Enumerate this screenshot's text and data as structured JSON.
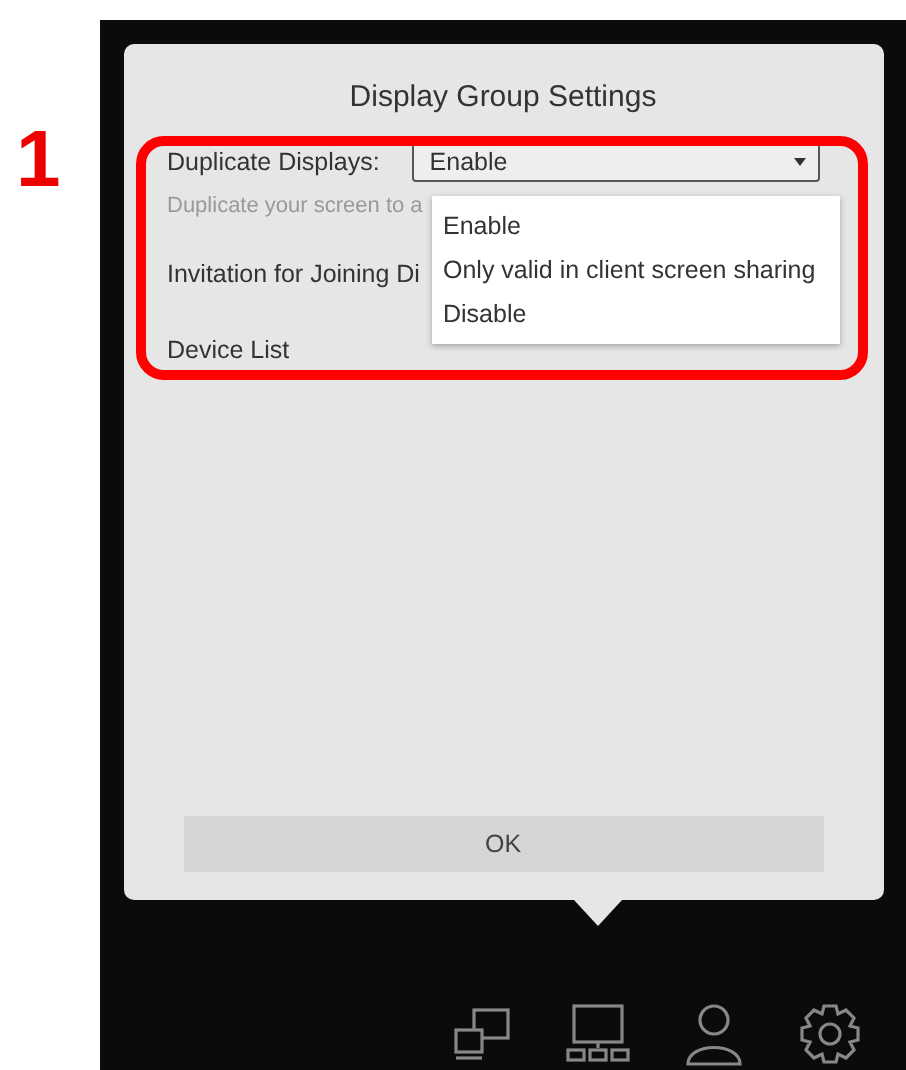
{
  "step_marker": "1",
  "dialog": {
    "title": "Display Group Settings",
    "duplicate_displays": {
      "label": "Duplicate Displays:",
      "value": "Enable"
    },
    "hint": "Duplicate your screen to a",
    "invitation_label": "Invitation for Joining Di",
    "device_list_label": "Device List",
    "dropdown_options": [
      "Enable",
      "Only valid in client screen sharing",
      "Disable"
    ],
    "ok_button": "OK"
  },
  "taskbar": [
    {
      "kind": "duplicate"
    },
    {
      "kind": "group"
    },
    {
      "kind": "user"
    },
    {
      "kind": "settings"
    }
  ]
}
